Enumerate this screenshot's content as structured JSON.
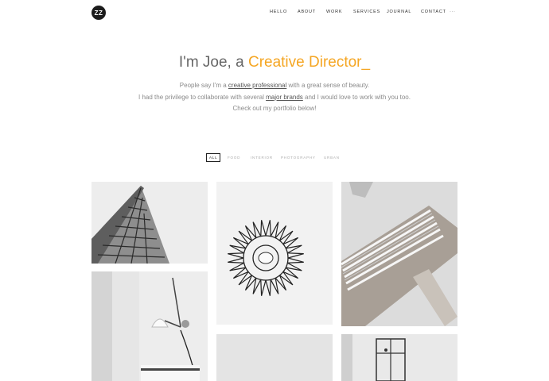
{
  "logo": {
    "text": "ZZ"
  },
  "nav": {
    "items": [
      "HELLO",
      "ABOUT",
      "WORK",
      "SERVICES",
      "JOURNAL",
      "CONTACT"
    ],
    "more": "···"
  },
  "hero": {
    "prefix": "I'm Joe, a ",
    "accent": "Creative Director_",
    "accent_color": "#f5a623",
    "line1_a": "People say I'm a ",
    "line1_link": "creative professional",
    "line1_b": " with a great sense of beauty.",
    "line2_a": "I had the privilege to collaborate with several ",
    "line2_link": "major brands",
    "line2_b": " and I would love to work with you too.",
    "line3": "Check out my portfolio below!"
  },
  "filters": [
    "ALL",
    "FOOD",
    "INTERIOR",
    "PHOTOGRAPHY",
    "URBAN"
  ],
  "portfolio": {
    "tiles": [
      "building-photo",
      "sunburst-mirror-photo",
      "wood-stack-photo",
      "wall-lamp-photo",
      "grey-photo",
      "window-photo"
    ]
  }
}
